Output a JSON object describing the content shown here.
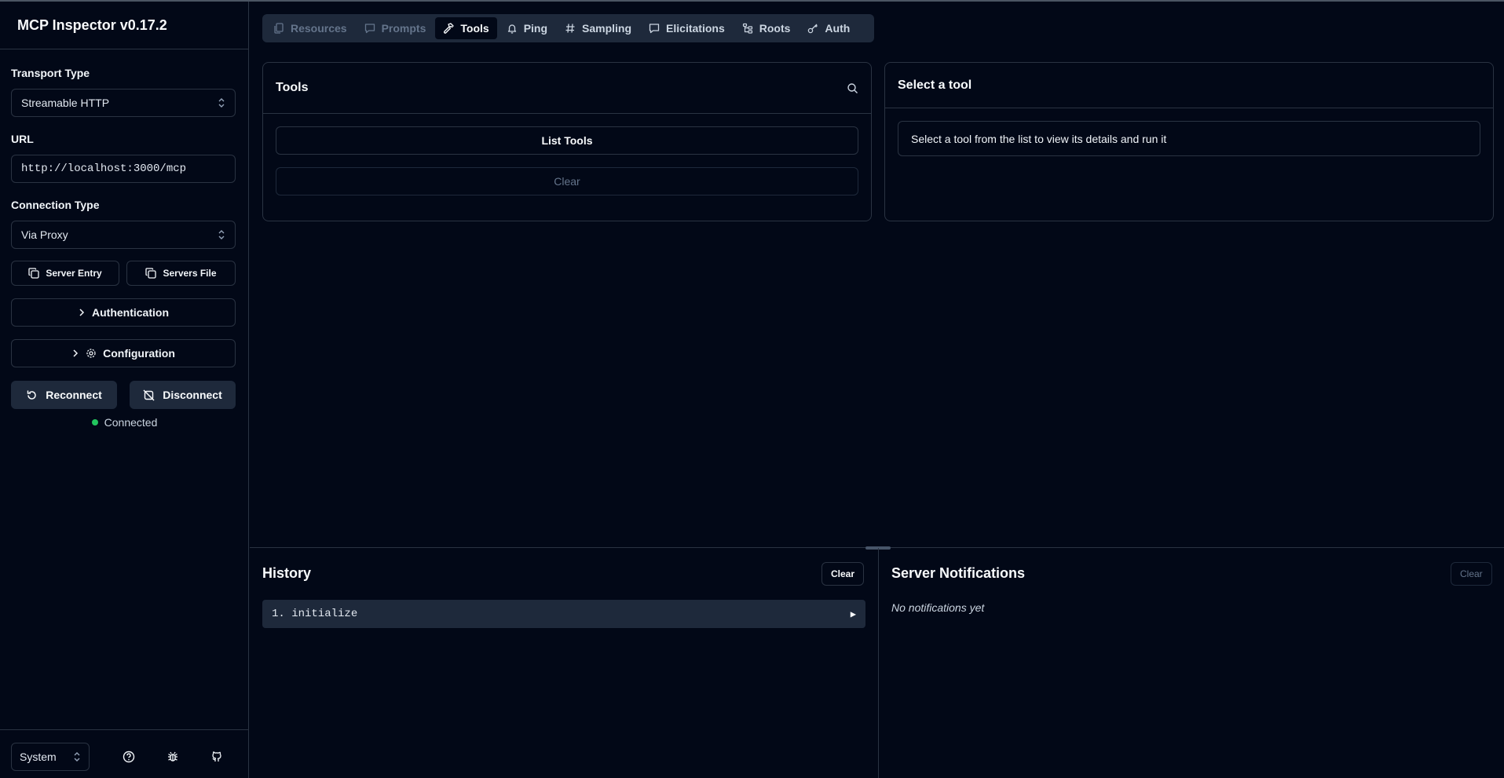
{
  "app": {
    "title": "MCP Inspector v0.17.2"
  },
  "sidebar": {
    "transport_label": "Transport Type",
    "transport_value": "Streamable HTTP",
    "url_label": "URL",
    "url_value": "http://localhost:3000/mcp",
    "connection_label": "Connection Type",
    "connection_value": "Via Proxy",
    "server_entry_label": "Server Entry",
    "servers_file_label": "Servers File",
    "authentication_label": "Authentication",
    "configuration_label": "Configuration",
    "reconnect_label": "Reconnect",
    "disconnect_label": "Disconnect",
    "status_text": "Connected",
    "status_color": "#22c55e",
    "theme_value": "System"
  },
  "tabs": [
    {
      "label": "Resources",
      "icon": "files-icon",
      "state": "disabled"
    },
    {
      "label": "Prompts",
      "icon": "message-icon",
      "state": "disabled"
    },
    {
      "label": "Tools",
      "icon": "hammer-icon",
      "state": "active"
    },
    {
      "label": "Ping",
      "icon": "bell-icon",
      "state": "normal"
    },
    {
      "label": "Sampling",
      "icon": "hash-icon",
      "state": "normal"
    },
    {
      "label": "Elicitations",
      "icon": "message-icon",
      "state": "normal"
    },
    {
      "label": "Roots",
      "icon": "folder-tree-icon",
      "state": "normal"
    },
    {
      "label": "Auth",
      "icon": "key-icon",
      "state": "normal"
    }
  ],
  "tools_panel": {
    "title": "Tools",
    "list_button": "List Tools",
    "clear_button": "Clear"
  },
  "detail_panel": {
    "title": "Select a tool",
    "message": "Select a tool from the list to view its details and run it"
  },
  "history": {
    "title": "History",
    "clear_button": "Clear",
    "items": [
      "1. initialize"
    ]
  },
  "notifications": {
    "title": "Server Notifications",
    "clear_button": "Clear",
    "empty_text": "No notifications yet"
  }
}
